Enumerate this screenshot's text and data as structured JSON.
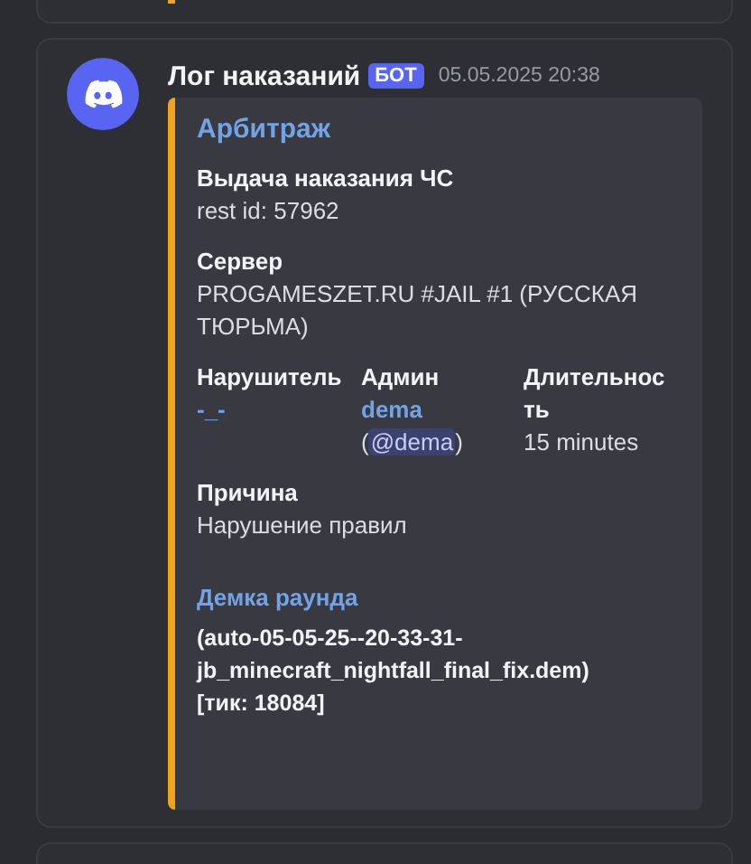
{
  "message": {
    "author": "Лог наказаний",
    "badge": "БОТ",
    "timestamp": "05.05.2025 20:38",
    "embed": {
      "title": "Арбитраж",
      "fields": [
        {
          "kind": "plain",
          "name": "Выдача наказания ЧС",
          "lines": [
            [
              {
                "kind": "text",
                "text": "rest id: 57962"
              }
            ]
          ]
        },
        {
          "kind": "plain",
          "name": "Сервер",
          "lines": [
            [
              {
                "kind": "text",
                "text": "PROGAMESZET.RU #JAIL #1 (РУССКАЯ ТЮРЬМА)"
              }
            ]
          ]
        },
        {
          "kind": "inline",
          "name": "Нарушитель",
          "lines": [
            [
              {
                "kind": "link",
                "text": "-_-"
              }
            ]
          ]
        },
        {
          "kind": "inline",
          "name": "Админ",
          "lines": [
            [
              {
                "kind": "link",
                "text": "dema"
              }
            ],
            [
              {
                "kind": "text",
                "text": "("
              },
              {
                "kind": "mention",
                "text": "@dema"
              },
              {
                "kind": "text",
                "text": ")"
              }
            ]
          ]
        },
        {
          "kind": "inline",
          "name": "Длительность",
          "lines": [
            [
              {
                "kind": "text",
                "text": "15 minutes"
              }
            ]
          ]
        },
        {
          "kind": "plain",
          "name": "Причина",
          "lines": [
            [
              {
                "kind": "text",
                "text": "Нарушение правил"
              }
            ]
          ]
        },
        {
          "kind": "link-heading",
          "name": "Демка раунда",
          "lines": [
            [
              {
                "kind": "bold",
                "text": "(auto-05-05-25--20-33-31-jb_minecraft_nightfall_final_fix.dem)"
              }
            ],
            [
              {
                "kind": "bold",
                "text": "[тик: 18084]"
              }
            ]
          ]
        }
      ]
    }
  }
}
